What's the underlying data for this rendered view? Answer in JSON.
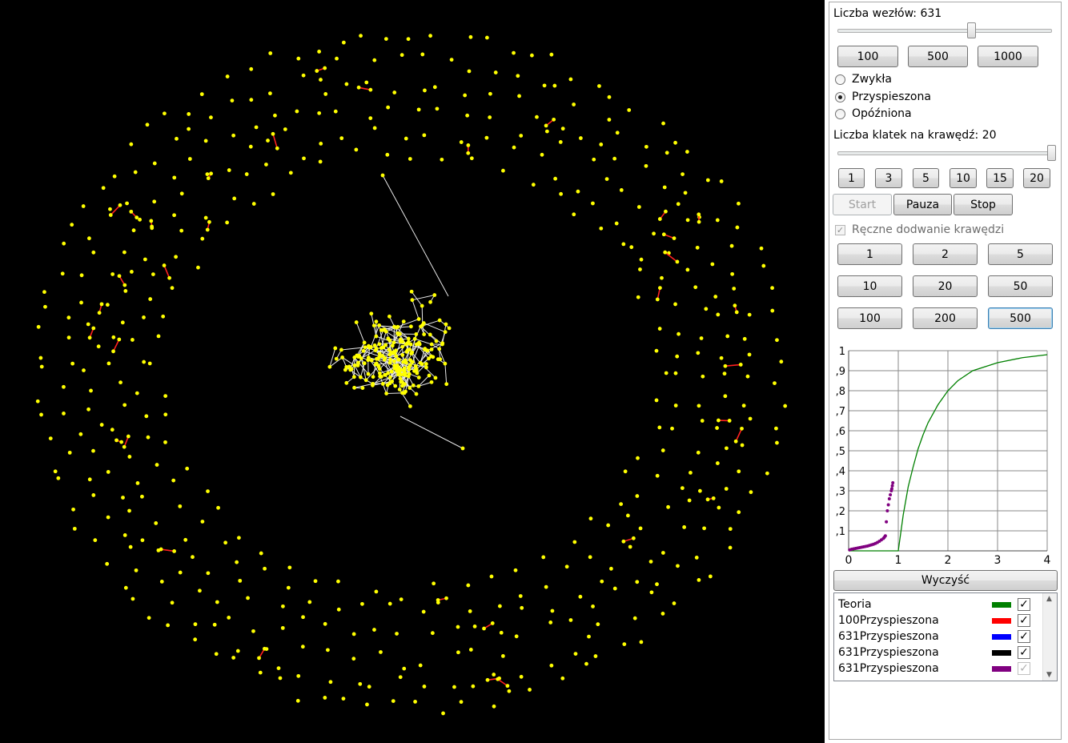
{
  "panel": {
    "nodes_label": "Liczba wezłów: 631",
    "nodes_slider_value": 631,
    "node_buttons": [
      "100",
      "500",
      "1000"
    ],
    "mode_options": [
      {
        "label": "Zwykła",
        "selected": false
      },
      {
        "label": "Przyspieszona",
        "selected": true
      },
      {
        "label": "Opóźniona",
        "selected": false
      }
    ],
    "frames_label": "Liczba klatek na krawędź: 20",
    "frames_slider_value": 20,
    "frame_buttons": [
      "1",
      "3",
      "5",
      "10",
      "15",
      "20"
    ],
    "control_buttons": {
      "start": "Start",
      "pause": "Pauza",
      "stop": "Stop"
    },
    "manual_edges_label": "Ręczne dodwanie krawędzi",
    "manual_edges_checked": true,
    "edge_buttons": [
      "1",
      "2",
      "5",
      "10",
      "20",
      "50",
      "100",
      "200",
      "500"
    ],
    "clear_button": "Wyczyść"
  },
  "legend": [
    {
      "name": "Teoria",
      "color": "#008000",
      "checked": true
    },
    {
      "name": "100Przyspieszona",
      "color": "#ff0000",
      "checked": true
    },
    {
      "name": "631Przyspieszona",
      "color": "#0000ff",
      "checked": true
    },
    {
      "name": "631Przyspieszona",
      "color": "#000000",
      "checked": true
    },
    {
      "name": "631Przyspieszona",
      "color": "#800080",
      "checked": true
    }
  ],
  "chart_data": {
    "type": "line",
    "xlim": [
      0,
      4
    ],
    "ylim": [
      0,
      1
    ],
    "x_ticks": [
      "0",
      "1",
      "2",
      "3",
      "4"
    ],
    "y_ticks": [
      ",1",
      ",2",
      ",3",
      ",4",
      ",5",
      ",6",
      ",7",
      ",8",
      ",9",
      "1"
    ],
    "grid": true,
    "series": [
      {
        "name": "Teoria",
        "color": "#008000",
        "style": "line",
        "x": [
          0,
          1.0,
          1.1,
          1.2,
          1.3,
          1.4,
          1.5,
          1.6,
          1.8,
          2.0,
          2.2,
          2.5,
          3.0,
          3.5,
          4.0
        ],
        "y": [
          0,
          0,
          0.18,
          0.32,
          0.42,
          0.51,
          0.58,
          0.64,
          0.73,
          0.8,
          0.85,
          0.9,
          0.94,
          0.965,
          0.98
        ]
      },
      {
        "name": "631Przyspieszona",
        "color": "#800080",
        "style": "points",
        "x": [
          0.02,
          0.06,
          0.1,
          0.14,
          0.18,
          0.22,
          0.26,
          0.3,
          0.34,
          0.38,
          0.42,
          0.46,
          0.5,
          0.54,
          0.58,
          0.62,
          0.66,
          0.7,
          0.72,
          0.74,
          0.76,
          0.78,
          0.8,
          0.82,
          0.84,
          0.86,
          0.87,
          0.88,
          0.89
        ],
        "y": [
          0.005,
          0.008,
          0.01,
          0.012,
          0.014,
          0.016,
          0.018,
          0.02,
          0.022,
          0.024,
          0.027,
          0.03,
          0.033,
          0.037,
          0.042,
          0.048,
          0.055,
          0.062,
          0.068,
          0.075,
          0.145,
          0.2,
          0.23,
          0.26,
          0.28,
          0.3,
          0.31,
          0.325,
          0.34
        ]
      }
    ]
  }
}
